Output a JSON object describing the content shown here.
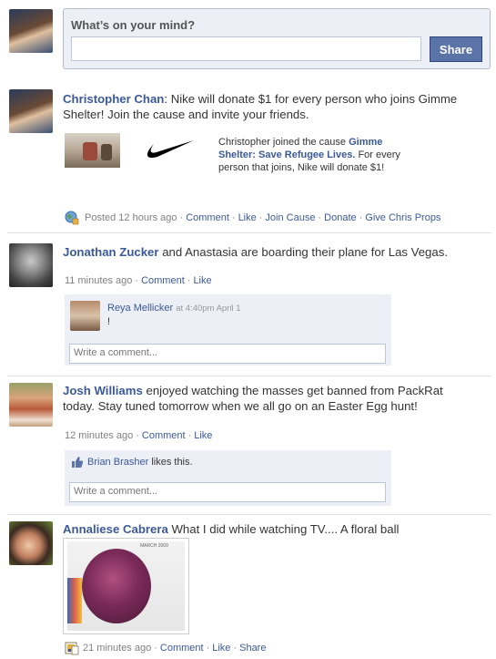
{
  "composer": {
    "prompt": "What’s on your mind?",
    "share_label": "Share"
  },
  "posts": [
    {
      "author": "Christopher Chan",
      "text_after_name": ":  Nike will donate $1 for every person who joins Gimme Shelter!  Join the cause and invite your friends.",
      "attachment_prefix": "Christopher joined the cause ",
      "attachment_cause": "Gimme Shelter: Save Refugee Lives.",
      "attachment_suffix": " For every person that joins, Nike will donate $1!",
      "posted_label": "Posted 12 hours ago",
      "actions": [
        "Comment",
        "Like",
        "Join Cause",
        "Donate",
        "Give Chris Props"
      ]
    },
    {
      "author": "Jonathan Zucker",
      "text_after_name": " and Anastasia are boarding their plane for Las Vegas.",
      "time": "11 minutes ago",
      "actions": [
        "Comment",
        "Like"
      ],
      "comment": {
        "author": "Reya Mellicker",
        "timestamp": "at 4:40pm April 1",
        "text": "!"
      },
      "comment_placeholder": "Write a comment..."
    },
    {
      "author": "Josh Williams",
      "text_after_name": " enjoyed watching the masses get banned from PackRat today. Stay tuned tomorrow when we all go on an Easter Egg hunt!",
      "time": "12 minutes ago",
      "actions": [
        "Comment",
        "Like"
      ],
      "like_name": "Brian Brasher",
      "like_suffix": " likes this.",
      "comment_placeholder": "Write a comment..."
    },
    {
      "author": "Annaliese Cabrera",
      "text_after_name": " What I did while watching TV.... A floral ball",
      "photo_caption": "MARCH 2009",
      "time": "21 minutes ago",
      "actions": [
        "Comment",
        "Like",
        "Share"
      ]
    }
  ],
  "icons": {
    "globe": "globe-icon",
    "thumb": "thumbs-up-icon",
    "photo": "photo-icon"
  },
  "colors": {
    "link": "#3b5998",
    "share_button": "#5b74a8",
    "panel": "#eceff5"
  }
}
